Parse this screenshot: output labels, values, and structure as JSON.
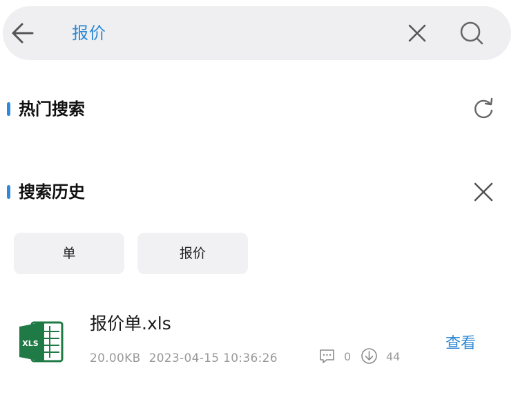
{
  "search": {
    "query": "报价",
    "icons": {
      "back": "arrow-left-icon",
      "clear": "close-icon",
      "search": "search-icon"
    }
  },
  "hot_search": {
    "title": "热门搜索",
    "refresh_icon": "refresh-icon"
  },
  "history": {
    "title": "搜索历史",
    "clear_icon": "close-icon",
    "items": [
      "单",
      "报价"
    ]
  },
  "results": [
    {
      "file_name": "报价单.xls",
      "file_icon": "excel-file-icon",
      "size": "20.00KB",
      "date": "2023-04-15 10:36:26",
      "comments": "0",
      "downloads": "44",
      "action": "查看"
    }
  ],
  "colors": {
    "accent": "#2e88d4",
    "section_marker": "#2e88e0",
    "search_bg": "#efeff1",
    "chip_bg": "#f1f1f3",
    "excel_green": "#1f7a45",
    "meta_gray": "#9a9a9a"
  }
}
